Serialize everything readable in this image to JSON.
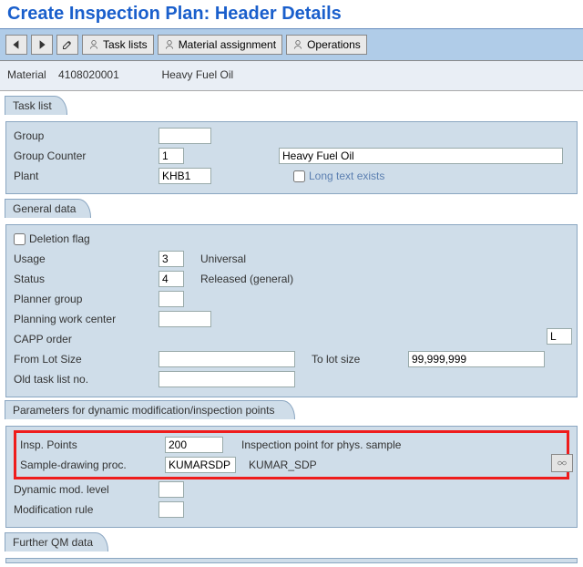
{
  "header": {
    "title": "Create Inspection Plan: Header Details"
  },
  "toolbar": {
    "task_lists": "Task lists",
    "material_assignment": "Material assignment",
    "operations": "Operations"
  },
  "material_row": {
    "label": "Material",
    "code": "4108020001",
    "desc": "Heavy Fuel Oil"
  },
  "tasklist": {
    "caption": "Task list",
    "group_label": "Group",
    "group_value": "",
    "counter_label": "Group Counter",
    "counter_value": "1",
    "counter_desc": "Heavy Fuel Oil",
    "plant_label": "Plant",
    "plant_value": "KHB1",
    "longtext_label": "Long text exists"
  },
  "general": {
    "caption": "General data",
    "deletion_flag": "Deletion flag",
    "usage_label": "Usage",
    "usage_value": "3",
    "usage_desc": "Universal",
    "status_label": "Status",
    "status_value": "4",
    "status_desc": "Released (general)",
    "planner_group_label": "Planner group",
    "planner_group_value": "",
    "pwc_label": "Planning work center",
    "pwc_value": "",
    "capp_label": "CAPP order",
    "from_lot_label": "From Lot Size",
    "from_lot_value": "",
    "to_lot_label": "To lot size",
    "to_lot_value": "99,999,999",
    "lot_unit": "L",
    "old_tl_label": "Old task list no.",
    "old_tl_value": ""
  },
  "params": {
    "caption": "Parameters for dynamic modification/inspection points",
    "insp_points_label": "Insp. Points",
    "insp_points_value": "200",
    "insp_points_desc": "Inspection point for phys. sample",
    "sdp_label": "Sample-drawing proc.",
    "sdp_value": "KUMARSDP",
    "sdp_desc": "KUMAR_SDP",
    "dyn_mod_label": "Dynamic mod. level",
    "mod_rule_label": "Modification rule"
  },
  "further": {
    "caption": "Further QM data"
  }
}
